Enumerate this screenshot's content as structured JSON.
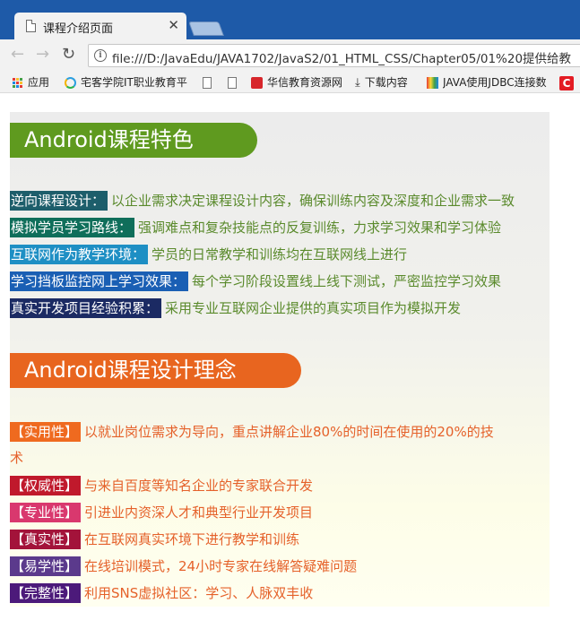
{
  "browser": {
    "tab_title": "课程介绍页面",
    "url": "file:///D:/JavaEdu/JAVA1702/JavaS2/01_HTML_CSS/Chapter05/01%20提供给教"
  },
  "bookmarks": [
    {
      "icon": "apps-icon",
      "label": "应用"
    },
    {
      "icon": "site-icon",
      "label": "宅客学院IT职业教育平"
    },
    {
      "icon": "page-icon",
      "label": ""
    },
    {
      "icon": "page-icon",
      "label": ""
    },
    {
      "icon": "huaxin-icon",
      "label": "华信教育资源网"
    },
    {
      "icon": "download-icon",
      "label": "下载内容"
    },
    {
      "icon": "java-icon",
      "label": "JAVA使用JDBC连接数"
    },
    {
      "icon": "c-icon",
      "label": ""
    }
  ],
  "section1": {
    "title": "Android课程特色",
    "color": "#5f9a1f",
    "items": [
      {
        "tag": "逆向课程设计：",
        "tag_color": "#1d5e6b",
        "desc": "以企业需求决定课程设计内容，确保训练内容及深度和企业需求一致"
      },
      {
        "tag": "模拟学员学习路线：",
        "tag_color": "#0f6e5a",
        "desc": "强调难点和复杂技能点的反复训练，力求学习效果和学习体验"
      },
      {
        "tag": "互联网作为教学环境：",
        "tag_color": "#1e8fc4",
        "desc": "学员的日常教学和训练均在互联网线上进行"
      },
      {
        "tag": "学习挡板监控网上学习效果：",
        "tag_color": "#1a5fb4",
        "desc": "每个学习阶段设置线上线下测试，严密监控学习效果"
      },
      {
        "tag": "真实开发项目经验积累：",
        "tag_color": "#1b2a63",
        "desc": "采用专业互联网企业提供的真实项目作为模拟开发"
      }
    ]
  },
  "section2": {
    "title": "Android课程设计理念",
    "color": "#e8651f",
    "items": [
      {
        "tag": "【实用性】",
        "tag_color": "#ef6a1f",
        "desc": "以就业岗位需求为导向，重点讲解企业80%的时间在使用的20%的技",
        "desc_cont": "术"
      },
      {
        "tag": "【权威性】",
        "tag_color": "#c0192c",
        "desc": "与来自百度等知名企业的专家联合开发"
      },
      {
        "tag": "【专业性】",
        "tag_color": "#d9386e",
        "desc": "引进业内资深人才和典型行业开发项目"
      },
      {
        "tag": "【真实性】",
        "tag_color": "#a3133a",
        "desc": "在互联网真实环境下进行教学和训练"
      },
      {
        "tag": "【易学性】",
        "tag_color": "#5b3a8c",
        "desc": "在线培训模式，24小时专家在线解答疑难问题"
      },
      {
        "tag": "【完整性】",
        "tag_color": "#4c1a7a",
        "desc": "利用SNS虚拟社区：学习、人脉双丰收"
      }
    ]
  }
}
